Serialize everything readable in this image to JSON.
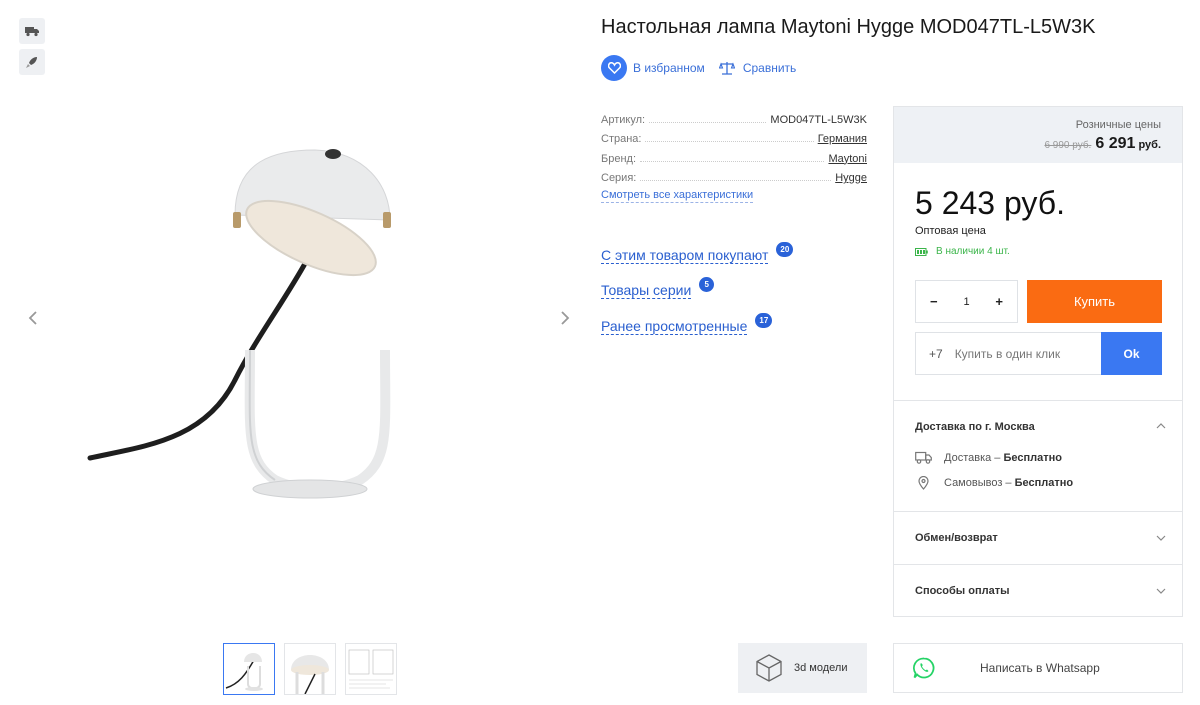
{
  "product": {
    "title": "Настольная лампа Maytoni Hygge MOD047TL-L5W3K"
  },
  "actions": {
    "favorite_label": "В избранном",
    "compare_label": "Сравнить"
  },
  "properties": [
    {
      "key": "Артикул:",
      "value": "MOD047TL-L5W3K"
    },
    {
      "key": "Страна:",
      "value": "Германия"
    },
    {
      "key": "Бренд:",
      "value": "Maytoni"
    },
    {
      "key": "Серия:",
      "value": "Hygge"
    }
  ],
  "all_specs_link": "Смотреть все характеристики",
  "related": [
    {
      "label": "С этим товаром покупают",
      "count": "20"
    },
    {
      "label": "Товары серии",
      "count": "5"
    },
    {
      "label": "Ранее просмотренные",
      "count": "17"
    }
  ],
  "pricing": {
    "retail_label": "Розничные цены",
    "retail_old": "6 990 руб.",
    "retail_new": "6 291",
    "retail_currency": "руб.",
    "wholesale_price": "5 243 руб.",
    "wholesale_label": "Оптовая цена",
    "stock": "В наличии 4 шт."
  },
  "cart": {
    "minus": "−",
    "quantity": "1",
    "plus": "+",
    "buy_label": "Купить",
    "phone_prefix": "+7",
    "oneclick_placeholder": "Купить в один клик",
    "ok_label": "Ok"
  },
  "delivery": {
    "title": "Доставка по г. Москва",
    "items": [
      {
        "label": "Доставка – ",
        "value": "Бесплатно"
      },
      {
        "label": "Самовывоз – ",
        "value": "Бесплатно"
      }
    ]
  },
  "sections": {
    "exchange": "Обмен/возврат",
    "payment": "Способы оплаты"
  },
  "bottom": {
    "models_3d": "3d модели",
    "whatsapp": "Написать в Whatsapp"
  },
  "colors": {
    "accent_blue": "#3a78f2",
    "buy_orange": "#fa6b12",
    "stock_green": "#3bb54a",
    "whatsapp_green": "#25d366"
  }
}
